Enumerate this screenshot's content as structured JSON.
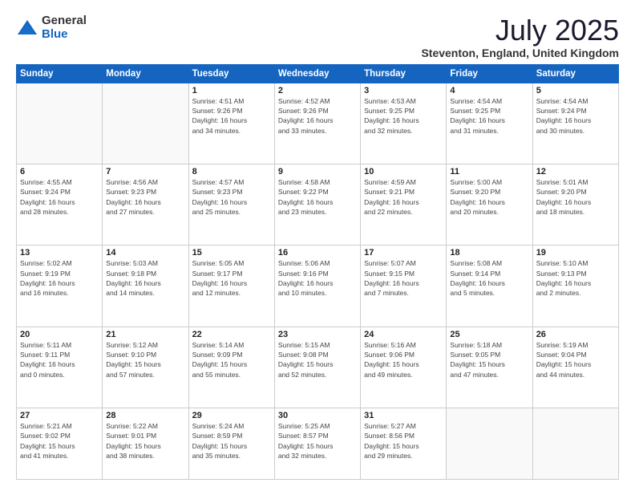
{
  "logo": {
    "general": "General",
    "blue": "Blue"
  },
  "header": {
    "month": "July 2025",
    "location": "Steventon, England, United Kingdom"
  },
  "weekdays": [
    "Sunday",
    "Monday",
    "Tuesday",
    "Wednesday",
    "Thursday",
    "Friday",
    "Saturday"
  ],
  "weeks": [
    [
      {
        "day": "",
        "info": ""
      },
      {
        "day": "",
        "info": ""
      },
      {
        "day": "1",
        "info": "Sunrise: 4:51 AM\nSunset: 9:26 PM\nDaylight: 16 hours\nand 34 minutes."
      },
      {
        "day": "2",
        "info": "Sunrise: 4:52 AM\nSunset: 9:26 PM\nDaylight: 16 hours\nand 33 minutes."
      },
      {
        "day": "3",
        "info": "Sunrise: 4:53 AM\nSunset: 9:25 PM\nDaylight: 16 hours\nand 32 minutes."
      },
      {
        "day": "4",
        "info": "Sunrise: 4:54 AM\nSunset: 9:25 PM\nDaylight: 16 hours\nand 31 minutes."
      },
      {
        "day": "5",
        "info": "Sunrise: 4:54 AM\nSunset: 9:24 PM\nDaylight: 16 hours\nand 30 minutes."
      }
    ],
    [
      {
        "day": "6",
        "info": "Sunrise: 4:55 AM\nSunset: 9:24 PM\nDaylight: 16 hours\nand 28 minutes."
      },
      {
        "day": "7",
        "info": "Sunrise: 4:56 AM\nSunset: 9:23 PM\nDaylight: 16 hours\nand 27 minutes."
      },
      {
        "day": "8",
        "info": "Sunrise: 4:57 AM\nSunset: 9:23 PM\nDaylight: 16 hours\nand 25 minutes."
      },
      {
        "day": "9",
        "info": "Sunrise: 4:58 AM\nSunset: 9:22 PM\nDaylight: 16 hours\nand 23 minutes."
      },
      {
        "day": "10",
        "info": "Sunrise: 4:59 AM\nSunset: 9:21 PM\nDaylight: 16 hours\nand 22 minutes."
      },
      {
        "day": "11",
        "info": "Sunrise: 5:00 AM\nSunset: 9:20 PM\nDaylight: 16 hours\nand 20 minutes."
      },
      {
        "day": "12",
        "info": "Sunrise: 5:01 AM\nSunset: 9:20 PM\nDaylight: 16 hours\nand 18 minutes."
      }
    ],
    [
      {
        "day": "13",
        "info": "Sunrise: 5:02 AM\nSunset: 9:19 PM\nDaylight: 16 hours\nand 16 minutes."
      },
      {
        "day": "14",
        "info": "Sunrise: 5:03 AM\nSunset: 9:18 PM\nDaylight: 16 hours\nand 14 minutes."
      },
      {
        "day": "15",
        "info": "Sunrise: 5:05 AM\nSunset: 9:17 PM\nDaylight: 16 hours\nand 12 minutes."
      },
      {
        "day": "16",
        "info": "Sunrise: 5:06 AM\nSunset: 9:16 PM\nDaylight: 16 hours\nand 10 minutes."
      },
      {
        "day": "17",
        "info": "Sunrise: 5:07 AM\nSunset: 9:15 PM\nDaylight: 16 hours\nand 7 minutes."
      },
      {
        "day": "18",
        "info": "Sunrise: 5:08 AM\nSunset: 9:14 PM\nDaylight: 16 hours\nand 5 minutes."
      },
      {
        "day": "19",
        "info": "Sunrise: 5:10 AM\nSunset: 9:13 PM\nDaylight: 16 hours\nand 2 minutes."
      }
    ],
    [
      {
        "day": "20",
        "info": "Sunrise: 5:11 AM\nSunset: 9:11 PM\nDaylight: 16 hours\nand 0 minutes."
      },
      {
        "day": "21",
        "info": "Sunrise: 5:12 AM\nSunset: 9:10 PM\nDaylight: 15 hours\nand 57 minutes."
      },
      {
        "day": "22",
        "info": "Sunrise: 5:14 AM\nSunset: 9:09 PM\nDaylight: 15 hours\nand 55 minutes."
      },
      {
        "day": "23",
        "info": "Sunrise: 5:15 AM\nSunset: 9:08 PM\nDaylight: 15 hours\nand 52 minutes."
      },
      {
        "day": "24",
        "info": "Sunrise: 5:16 AM\nSunset: 9:06 PM\nDaylight: 15 hours\nand 49 minutes."
      },
      {
        "day": "25",
        "info": "Sunrise: 5:18 AM\nSunset: 9:05 PM\nDaylight: 15 hours\nand 47 minutes."
      },
      {
        "day": "26",
        "info": "Sunrise: 5:19 AM\nSunset: 9:04 PM\nDaylight: 15 hours\nand 44 minutes."
      }
    ],
    [
      {
        "day": "27",
        "info": "Sunrise: 5:21 AM\nSunset: 9:02 PM\nDaylight: 15 hours\nand 41 minutes."
      },
      {
        "day": "28",
        "info": "Sunrise: 5:22 AM\nSunset: 9:01 PM\nDaylight: 15 hours\nand 38 minutes."
      },
      {
        "day": "29",
        "info": "Sunrise: 5:24 AM\nSunset: 8:59 PM\nDaylight: 15 hours\nand 35 minutes."
      },
      {
        "day": "30",
        "info": "Sunrise: 5:25 AM\nSunset: 8:57 PM\nDaylight: 15 hours\nand 32 minutes."
      },
      {
        "day": "31",
        "info": "Sunrise: 5:27 AM\nSunset: 8:56 PM\nDaylight: 15 hours\nand 29 minutes."
      },
      {
        "day": "",
        "info": ""
      },
      {
        "day": "",
        "info": ""
      }
    ]
  ]
}
